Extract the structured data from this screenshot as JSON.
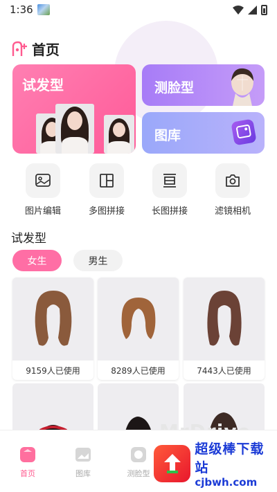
{
  "status_bar": {
    "time": "1:36"
  },
  "header": {
    "title": "首页"
  },
  "feature_cards": {
    "try_hairstyle": "试发型",
    "face_shape": "测脸型",
    "gallery": "图库"
  },
  "tools": [
    {
      "label": "图片编辑",
      "icon": "image-edit-icon"
    },
    {
      "label": "多图拼接",
      "icon": "grid-collage-icon"
    },
    {
      "label": "长图拼接",
      "icon": "long-image-icon"
    },
    {
      "label": "滤镜相机",
      "icon": "camera-icon"
    }
  ],
  "section": {
    "title": "试发型",
    "tabs": [
      {
        "label": "女生",
        "active": true
      },
      {
        "label": "男生",
        "active": false
      }
    ]
  },
  "hairstyles": [
    {
      "usage": "9159人已使用",
      "color": "#8a5a3c"
    },
    {
      "usage": "8289人已使用",
      "color": "#a0643a"
    },
    {
      "usage": "7443人已使用",
      "color": "#6b4236"
    }
  ],
  "bottom_nav": [
    {
      "label": "首页",
      "active": true,
      "color": "#ff5a8f"
    },
    {
      "label": "图库",
      "active": false,
      "color": "#bbbbbb"
    },
    {
      "label": "测脸型",
      "active": false,
      "color": "#bbbbbb"
    }
  ],
  "watermark": {
    "text": "MrDrive"
  },
  "brand": {
    "line1": "超级棒下载站",
    "line2": "cjbwh.com"
  },
  "colors": {
    "accent": "#ff6ea5",
    "hair_card": "#ff5a98",
    "face_card": "#a77cf7",
    "gallery_card": "#9aa8fa"
  }
}
